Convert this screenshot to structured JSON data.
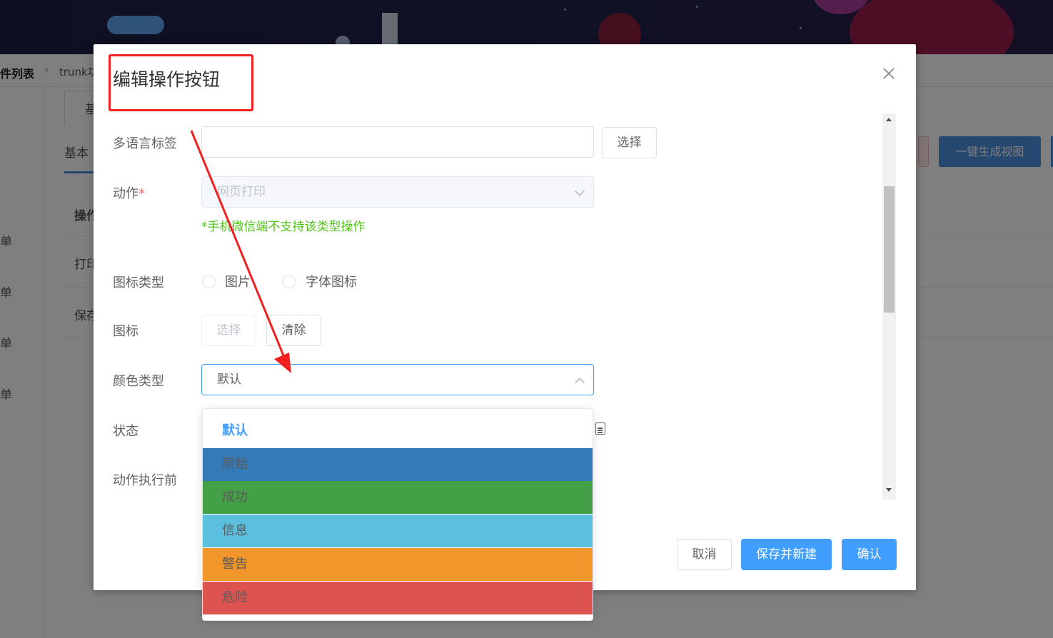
{
  "background": {
    "breadcrumb": {
      "current": "件列表",
      "next": "trunk功"
    },
    "sidebar_items": [
      "单",
      "单",
      "单",
      "单"
    ],
    "tab_label": "基",
    "sub_tab_label": "基本",
    "rows": [
      "操作",
      "打印",
      "保存"
    ],
    "generate_button": "一键生成视图"
  },
  "dialog": {
    "title": "编辑操作按钮",
    "fields": {
      "i18n_label": {
        "label": "多语言标签",
        "value": "",
        "button": "选择"
      },
      "action": {
        "label": "动作",
        "required_mark": "*",
        "value": "网页打印",
        "hint": "*手机微信端不支持该类型操作"
      },
      "icon_type": {
        "label": "图标类型",
        "options": [
          "图片",
          "字体图标"
        ]
      },
      "icon": {
        "label": "图标",
        "select_button": "选择",
        "clear_button": "清除"
      },
      "color_type": {
        "label": "颜色类型",
        "value": "默认"
      },
      "status": {
        "label": "状态"
      },
      "before_action": {
        "label": "动作执行前"
      }
    },
    "color_options": [
      {
        "label": "默认",
        "bg": "#ffffff",
        "selected": true
      },
      {
        "label": "原始",
        "bg": "#337ab7"
      },
      {
        "label": "成功",
        "bg": "#43a046"
      },
      {
        "label": "信息",
        "bg": "#5bc0de"
      },
      {
        "label": "警告",
        "bg": "#f0962a"
      },
      {
        "label": "危险",
        "bg": "#dc5350"
      }
    ],
    "footer": {
      "cancel": "取消",
      "save_new": "保存并新建",
      "confirm": "确认"
    }
  },
  "colors": {
    "primary": "#409eff",
    "annotation": "#f02020",
    "hint": "#52c41a"
  }
}
